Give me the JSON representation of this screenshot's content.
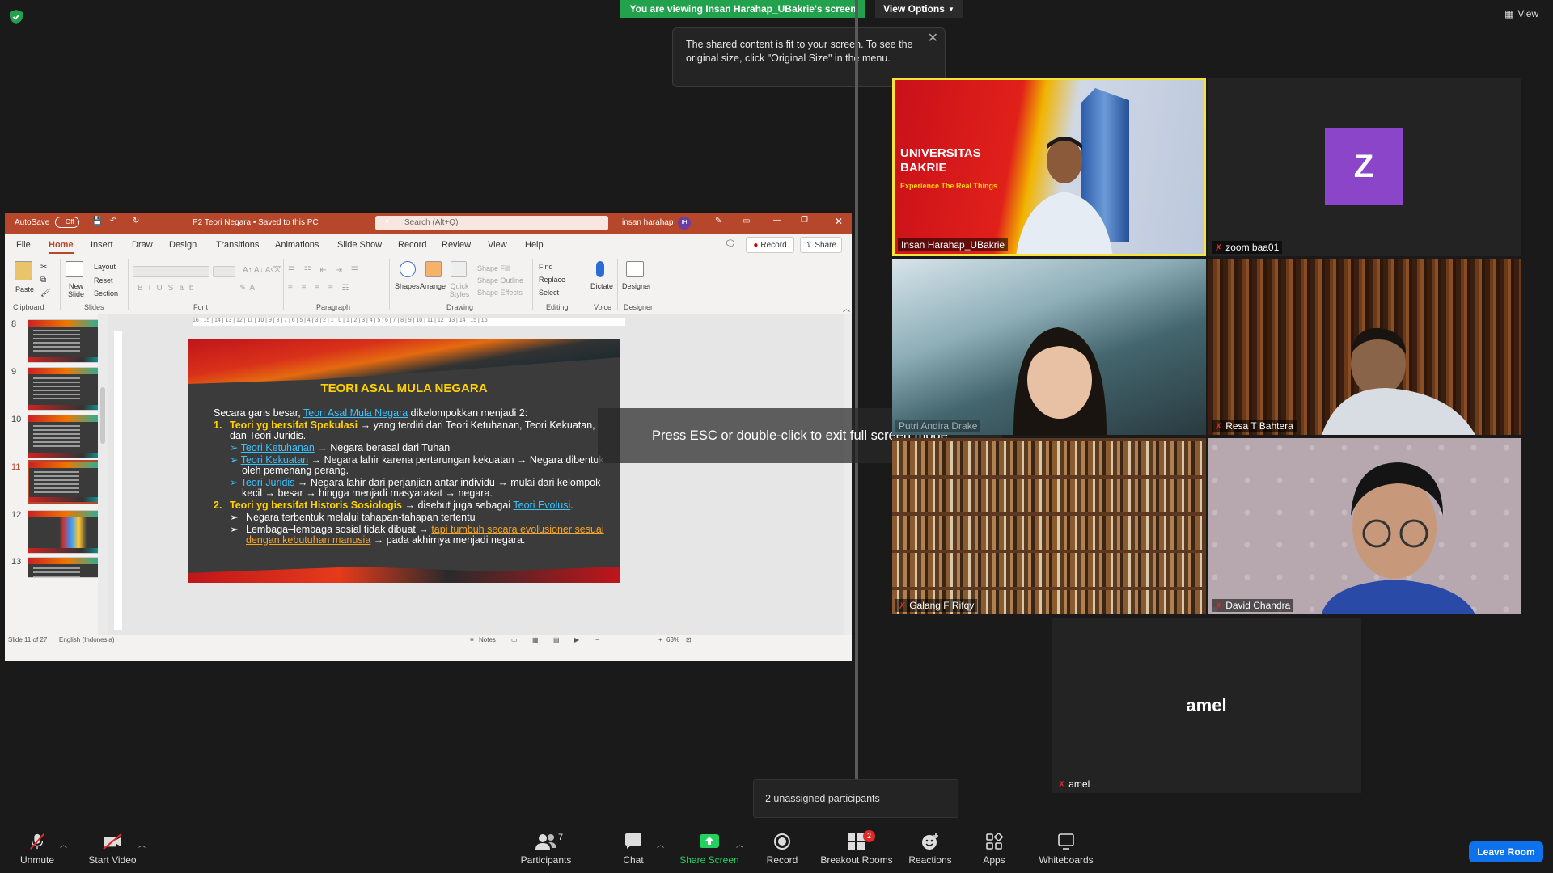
{
  "banner": {
    "viewing_text": "You are viewing Insan Harahap_UBakrie's screen",
    "view_options": "View Options",
    "view_label": "View"
  },
  "tooltip": {
    "text": "The shared content is fit to your screen. To see the original size, click \"Original Size\" in the menu."
  },
  "fullscreen_notice": "Press ESC or double-click to exit full screen mode",
  "ppt": {
    "autosave": "AutoSave",
    "autosave_state": "Off",
    "filename": "P2 Teori Negara • Saved to this PC",
    "search_placeholder": "Search (Alt+Q)",
    "user": "insan harahap",
    "user_initials": "IH",
    "tabs": [
      "File",
      "Home",
      "Insert",
      "Draw",
      "Design",
      "Transitions",
      "Animations",
      "Slide Show",
      "Record",
      "Review",
      "View",
      "Help"
    ],
    "active_tab": "Home",
    "record_label": "Record",
    "share_label": "Share",
    "ribbon": {
      "paste": "Paste",
      "new_slide": "New Slide",
      "layout": "Layout",
      "reset": "Reset",
      "section": "Section",
      "shapes": "Shapes",
      "arrange": "Arrange",
      "quick_styles": "Quick Styles",
      "shape_fill": "Shape Fill",
      "shape_outline": "Shape Outline",
      "shape_effects": "Shape Effects",
      "find": "Find",
      "replace": "Replace",
      "select": "Select",
      "dictate": "Dictate",
      "designer": "Designer",
      "groups": [
        "Clipboard",
        "Slides",
        "Font",
        "Paragraph",
        "Drawing",
        "Editing",
        "Voice",
        "Designer"
      ]
    },
    "thumbnails": [
      {
        "num": "8",
        "active": false
      },
      {
        "num": "9",
        "active": false
      },
      {
        "num": "10",
        "active": false
      },
      {
        "num": "11",
        "active": true
      },
      {
        "num": "12",
        "active": false
      },
      {
        "num": "13",
        "active": false
      }
    ],
    "ruler_text": "16 | 15 | 14 | 13 | 12 | 11 | 10 | 9 | 8 | 7 | 6 | 5 | 4 | 3 | 2 | 1 | 0 | 1 | 2 | 3 | 4 | 5 | 6 | 7 | 8 | 9 | 10 | 11 | 12 | 13 | 14 | 15 | 16",
    "status": {
      "slide": "Slide 11 of 27",
      "language": "English (Indonesia)",
      "notes": "Notes",
      "zoom": "63%"
    }
  },
  "slide": {
    "title": "TEORI ASAL MULA NEGARA",
    "intro_a": "Secara garis besar, ",
    "intro_link": "Teori Asal Mula Negara",
    "intro_b": " dikelompokkan menjadi 2:",
    "p1_num": "1.",
    "p1_title": "Teori yg bersifat Spekulasi",
    "p1_rest": " → yang terdiri dari Teori Ketuhanan, Teori Kekuatan, dan Teori Juridis.",
    "b1_link": "Teori Ketuhanan",
    "b1_rest": " → Negara berasal dari Tuhan",
    "b2_link": "Teori Kekuatan",
    "b2_rest": " → Negara lahir karena pertarungan kekuatan → Negara dibentuk oleh pemenang perang.",
    "b3_link": "Teori Juridis",
    "b3_rest": " → Negara lahir dari perjanjian antar individu → mulai dari kelompok kecil → besar → hingga menjadi masyarakat → negara.",
    "p2_num": "2.",
    "p2_title": "Teori yg bersifat Historis Sosiologis",
    "p2_rest": " → disebut juga sebagai ",
    "p2_link": "Teori Evolusi",
    "p2_end": ".",
    "c1": "Negara terbentuk melalui tahapan-tahapan tertentu",
    "c2_a": "Lembaga–lembaga sosial tidak dibuat → ",
    "c2_link": "tapi tumbuh secara evolusioner sesuai dengan kebutuhan manusia",
    "c2_b": " → pada akhirnya menjadi negara."
  },
  "participants": {
    "insan": {
      "name": "Insan Harahap_UBakrie",
      "bg_text_1": "UNIVERSITAS",
      "bg_text_2": "BAKRIE",
      "bg_tagline": "Experience The Real Things"
    },
    "zoom": {
      "name": "zoom baa01",
      "initial": "Z"
    },
    "putri": {
      "name": "Putri Andira Drake"
    },
    "resa": {
      "name": "Resa T Bahtera"
    },
    "galang": {
      "name": "Galang F Rifqy"
    },
    "david": {
      "name": "David Chandra"
    },
    "amel": {
      "name": "amel",
      "display": "amel"
    }
  },
  "unassigned": "2 unassigned participants",
  "toolbar": {
    "unmute": "Unmute",
    "start_video": "Start Video",
    "participants": "Participants",
    "participants_count": "7",
    "chat": "Chat",
    "share_screen": "Share Screen",
    "record": "Record",
    "breakout_rooms": "Breakout Rooms",
    "breakout_badge": "2",
    "reactions": "Reactions",
    "apps": "Apps",
    "whiteboards": "Whiteboards",
    "leave": "Leave Room"
  },
  "colors": {
    "zoom_green": "#23a24d",
    "ppt_red": "#b7472a",
    "leave_blue": "#0e72ed",
    "active_speaker": "#f6e33c",
    "slide_yellow": "#ffd200",
    "slide_link_blue": "#39c3ff",
    "avatar_purple": "#8b45c9"
  }
}
